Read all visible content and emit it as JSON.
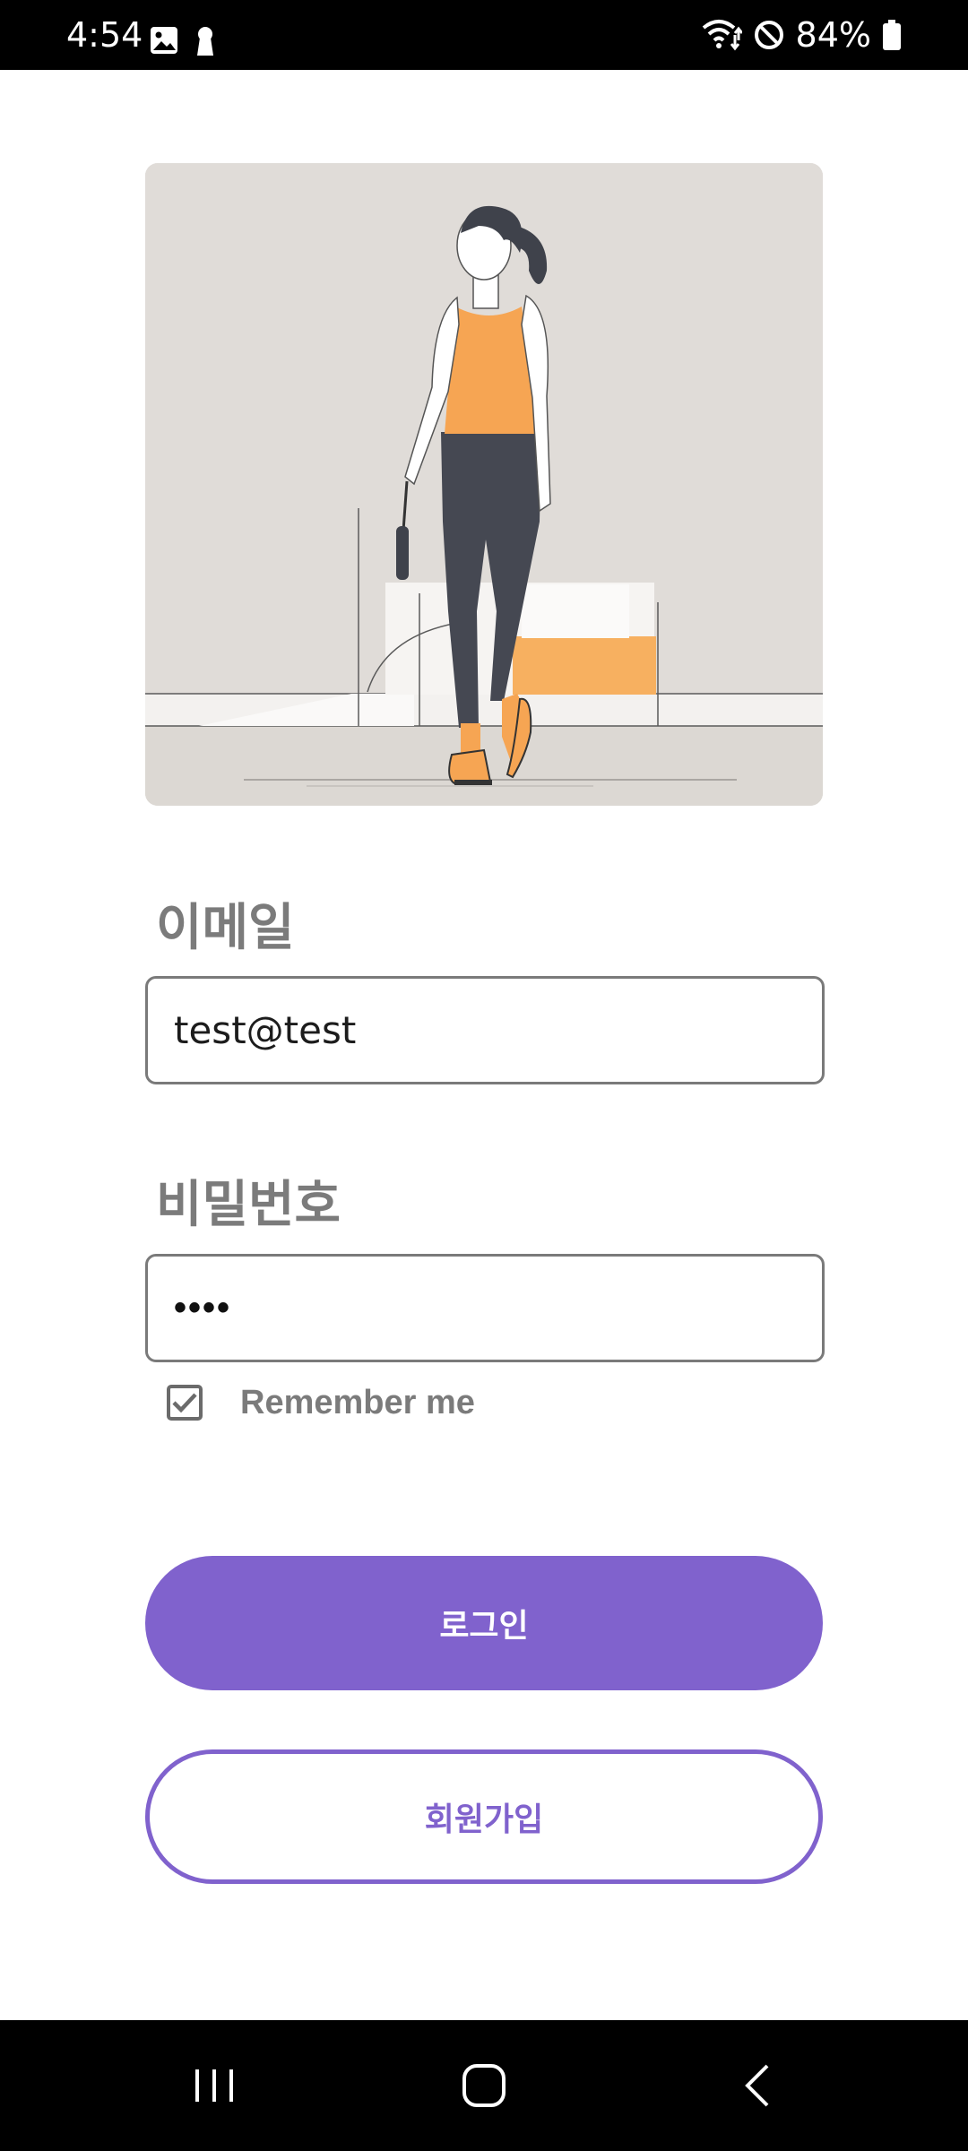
{
  "status_bar": {
    "time": "4:54",
    "left_icons": [
      "image-icon",
      "keyhole-icon"
    ],
    "right_icons": [
      "wifi-icon",
      "do-not-disturb-icon",
      "battery-icon"
    ],
    "battery_text": "84%"
  },
  "hero": {
    "illustration": "walking-woman-illustration"
  },
  "email": {
    "label": "이메일",
    "value": "test@test"
  },
  "password": {
    "label": "비밀번호",
    "masked_value": "••••"
  },
  "remember": {
    "label": "Remember me",
    "checked": true
  },
  "buttons": {
    "login": "로그인",
    "signup": "회원가입"
  },
  "nav": {
    "recents": "recents-icon",
    "home": "home-icon",
    "back": "back-icon"
  },
  "colors": {
    "accent": "#8062cd",
    "label_gray": "#7b7b7b",
    "field_border": "#7a7a7a"
  }
}
